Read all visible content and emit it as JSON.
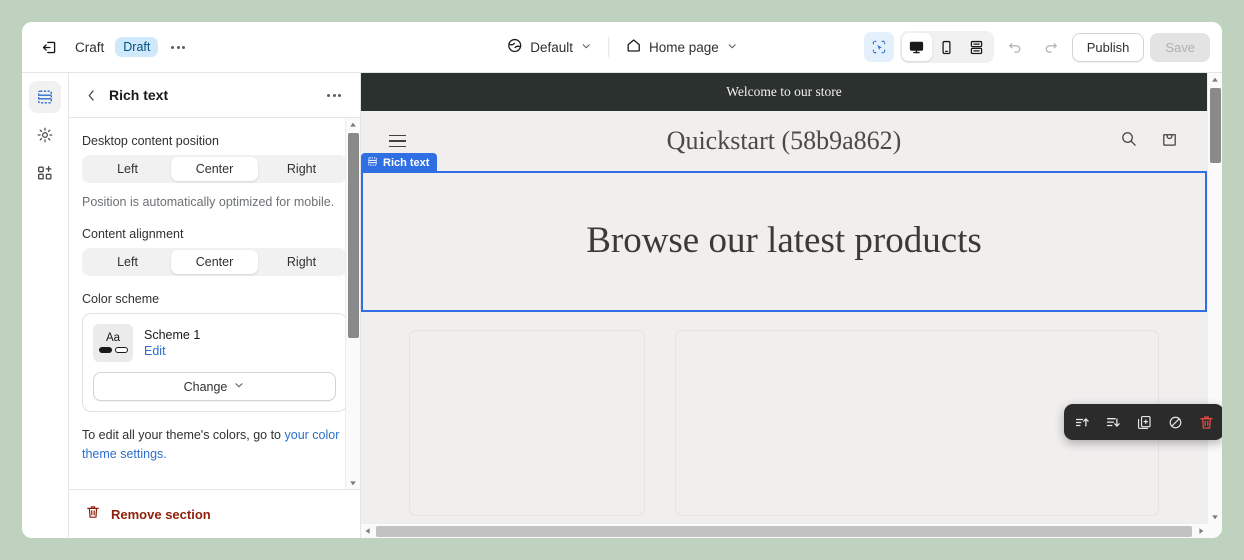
{
  "topbar": {
    "exit_icon": "exit-icon",
    "app_name": "Craft",
    "status_badge": "Draft",
    "more_icon": "more-dots-icon",
    "theme_selector": {
      "icon": "globe-icon",
      "label": "Default",
      "chevron": "chevron-down-icon"
    },
    "page_selector": {
      "icon": "home-icon",
      "label": "Home page",
      "chevron": "chevron-down-icon"
    },
    "select_tool_icon": "cursor-select-icon",
    "devices": [
      {
        "name": "desktop",
        "icon": "desktop-icon",
        "active": true
      },
      {
        "name": "mobile",
        "icon": "mobile-icon",
        "active": false
      },
      {
        "name": "fullscreen",
        "icon": "fullscreen-icon",
        "active": false
      }
    ],
    "undo_icon": "undo-icon",
    "redo_icon": "redo-icon",
    "publish_label": "Publish",
    "save_label": "Save"
  },
  "rail": {
    "items": [
      {
        "name": "sections",
        "icon": "sections-icon",
        "active": true
      },
      {
        "name": "theme-settings",
        "icon": "gear-icon",
        "active": false
      },
      {
        "name": "apps",
        "icon": "apps-add-icon",
        "active": false
      }
    ]
  },
  "panel": {
    "back_icon": "chevron-left-icon",
    "title": "Rich text",
    "more_icon": "more-dots-icon",
    "desktop_position": {
      "label": "Desktop content position",
      "options": [
        "Left",
        "Center",
        "Right"
      ],
      "selected": "Center",
      "help": "Position is automatically optimized for mobile."
    },
    "content_alignment": {
      "label": "Content alignment",
      "options": [
        "Left",
        "Center",
        "Right"
      ],
      "selected": "Center"
    },
    "color_scheme": {
      "label": "Color scheme",
      "swatch_text": "Aa",
      "scheme_name": "Scheme 1",
      "edit_label": "Edit",
      "change_label": "Change",
      "change_chevron": "chevron-down-icon"
    },
    "theme_note": "To edit all your theme's colors, go to",
    "theme_note_link": "your color theme settings.",
    "remove_icon": "trash-icon",
    "remove_label": "Remove section"
  },
  "preview": {
    "announcement": "Welcome to our store",
    "menu_icon": "hamburger-menu-icon",
    "store_title": "Quickstart (58b9a862)",
    "search_icon": "search-icon",
    "cart_icon": "shopping-bag-icon",
    "section_tag": {
      "icon": "rich-text-icon",
      "label": "Rich text"
    },
    "hero_heading": "Browse our latest products",
    "floating_toolbar": [
      {
        "name": "move-up",
        "icon": "move-up-icon"
      },
      {
        "name": "move-down",
        "icon": "move-down-icon"
      },
      {
        "name": "duplicate",
        "icon": "duplicate-icon"
      },
      {
        "name": "hide",
        "icon": "hide-eye-icon"
      },
      {
        "name": "delete",
        "icon": "trash-icon"
      }
    ]
  },
  "colors": {
    "accent_blue": "#2f6ee3",
    "link_blue": "#2c6ecb",
    "badge_bg": "#cfe8fb",
    "badge_text": "#00527c",
    "danger_red": "#8e1f0b",
    "toolbar_delete_red": "#e64a3f",
    "canvas_bg": "#bed2bf",
    "preview_bg": "#f1eeee",
    "announce_bg": "#2b312e"
  }
}
